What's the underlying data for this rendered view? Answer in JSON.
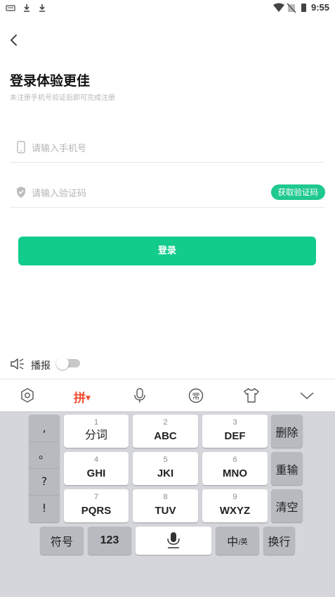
{
  "status_bar": {
    "time": "9:55"
  },
  "header": {
    "title": "登录体验更佳",
    "subtitle": "未注册手机号验证后即可完成注册"
  },
  "form": {
    "phone_placeholder": "请输入手机号",
    "code_placeholder": "请输入验证码",
    "get_code_label": "获取验证码",
    "login_label": "登录"
  },
  "broadcast": {
    "label": "播报",
    "enabled": false
  },
  "ime_toolbar": {
    "pinyin_label": "拼",
    "accent": "#f04a2e"
  },
  "keyboard": {
    "punct": [
      ",",
      "。",
      "?",
      "!"
    ],
    "keys": [
      {
        "num": "1",
        "label": "分词"
      },
      {
        "num": "2",
        "label": "ABC"
      },
      {
        "num": "3",
        "label": "DEF"
      },
      {
        "num": "4",
        "label": "GHI"
      },
      {
        "num": "5",
        "label": "JKI"
      },
      {
        "num": "6",
        "label": "MNO"
      },
      {
        "num": "7",
        "label": "PQRS"
      },
      {
        "num": "8",
        "label": "TUV"
      },
      {
        "num": "9",
        "label": "WXYZ"
      }
    ],
    "delete_label": "删除",
    "reinput_label": "重输",
    "clear_label": "清空",
    "symbol_label": "符号",
    "num_label": "123",
    "lang_main": "中",
    "lang_sub": "/英",
    "newline_label": "换行"
  },
  "colors": {
    "brand": "#12cc8c"
  }
}
